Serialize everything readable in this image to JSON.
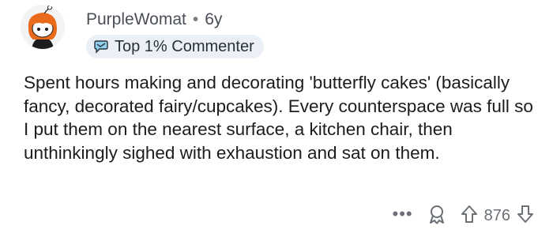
{
  "comment": {
    "author": "PurpleWomat",
    "separator": "•",
    "age": "6y",
    "badge_label": "Top 1% Commenter",
    "body": "Spent hours making and decorating 'butterfly cakes' (basically fancy, decorated fairy/cupcakes). Every counterspace was full so I put them on the nearest surface, a kitchen chair, then unthinkingly sighed with exhaustion and sat on them.",
    "score": "876",
    "more_label": "•••"
  },
  "icons": {
    "avatar": "snoo-avatar-orange-hair",
    "badge": "top-commenter-icon",
    "award": "award-icon",
    "upvote": "upvote-arrow-icon",
    "downvote": "downvote-arrow-icon"
  },
  "colors": {
    "badge_bg": "#eaf0f5",
    "meta_text": "#4a4f57",
    "action_gray": "#6b7077",
    "avatar_hair": "#e86a1a"
  }
}
